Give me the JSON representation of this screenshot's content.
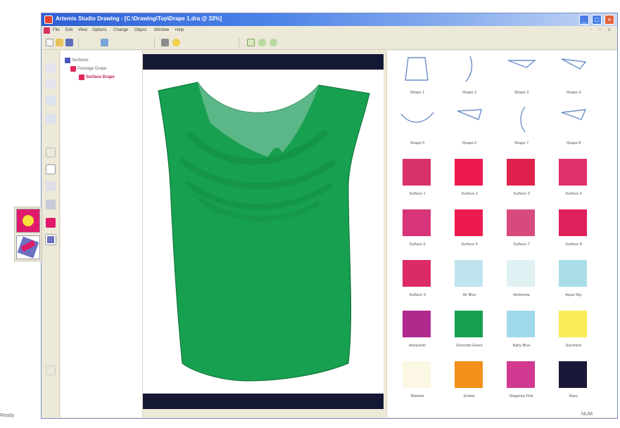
{
  "window": {
    "title": "Artemis Studio Drawing - [C:\\Drawing\\Top\\Drape 1.dra @ 33%]",
    "controls": [
      "_",
      "□",
      "×"
    ]
  },
  "menu": {
    "items": [
      "File",
      "Edit",
      "View",
      "Options",
      "Change",
      "Object",
      "Window",
      "Help"
    ],
    "right_controls": [
      "-",
      "▫",
      "x"
    ]
  },
  "toolbar": {
    "icons": [
      "new-icon",
      "open-icon",
      "save-icon",
      "draw-icon",
      "print-icon",
      "light-icon",
      "page-icon",
      "zoom-in-icon",
      "zoom-out-icon"
    ]
  },
  "tree": {
    "items": [
      {
        "label": "Surfaces",
        "level": 0
      },
      {
        "label": "Package Drape",
        "level": 1
      },
      {
        "label": "Surface Drape",
        "level": 2,
        "active": true
      }
    ]
  },
  "library": {
    "items": [
      {
        "label": "Shape 1",
        "kind": "shape"
      },
      {
        "label": "Shape 2",
        "kind": "shape"
      },
      {
        "label": "Shape 3",
        "kind": "shape"
      },
      {
        "label": "Shape 4",
        "kind": "shape"
      },
      {
        "label": "Shape 5",
        "kind": "shape"
      },
      {
        "label": "Shape 6",
        "kind": "shape"
      },
      {
        "label": "Shape 7",
        "kind": "shape"
      },
      {
        "label": "Shape 8",
        "kind": "shape"
      },
      {
        "label": "Surface 1",
        "kind": "swatch",
        "color": "#d8306a"
      },
      {
        "label": "Surface 2",
        "kind": "swatch",
        "color": "#ec1a4f"
      },
      {
        "label": "Surface 3",
        "kind": "swatch",
        "color": "#e0204d"
      },
      {
        "label": "Surface 4",
        "kind": "swatch",
        "color": "#e0306a"
      },
      {
        "label": "Surface 5",
        "kind": "swatch",
        "color": "#d8347a"
      },
      {
        "label": "Surface 6",
        "kind": "swatch",
        "color": "#ec1a4f"
      },
      {
        "label": "Surface 7",
        "kind": "swatch",
        "color": "#d84a7e"
      },
      {
        "label": "Surface 8",
        "kind": "swatch",
        "color": "#e0205a"
      },
      {
        "label": "Surface 9",
        "kind": "swatch",
        "color": "#dc2a66"
      },
      {
        "label": "Air Blue",
        "kind": "swatch",
        "color": "#bfe3ef"
      },
      {
        "label": "Ambrosia",
        "kind": "swatch",
        "color": "#dff1f2"
      },
      {
        "label": "Aqua Sky",
        "kind": "swatch",
        "color": "#a9dde9"
      },
      {
        "label": "Amaranth",
        "kind": "swatch",
        "color": "#b02a8e"
      },
      {
        "label": "Emerald Green",
        "kind": "swatch",
        "color": "#18a050"
      },
      {
        "label": "Baby Blue",
        "kind": "swatch",
        "color": "#a0d8ec"
      },
      {
        "label": "Sunshine",
        "kind": "swatch",
        "color": "#f8ec58"
      },
      {
        "label": "Blanket",
        "kind": "swatch",
        "color": "#fbf7e4"
      },
      {
        "label": "Ember",
        "kind": "swatch",
        "color": "#f2901a"
      },
      {
        "label": "Magenta Pink",
        "kind": "swatch",
        "color": "#d23a92"
      },
      {
        "label": "Navy",
        "kind": "swatch",
        "color": "#1a1838"
      }
    ]
  },
  "colors": {
    "garment": "#17a04f",
    "garment_shadow": "#128a42",
    "garment_inner": "#5fb88a",
    "canvas_bar": "#141834"
  },
  "status": {
    "left": "Ready",
    "right": "NUM"
  }
}
